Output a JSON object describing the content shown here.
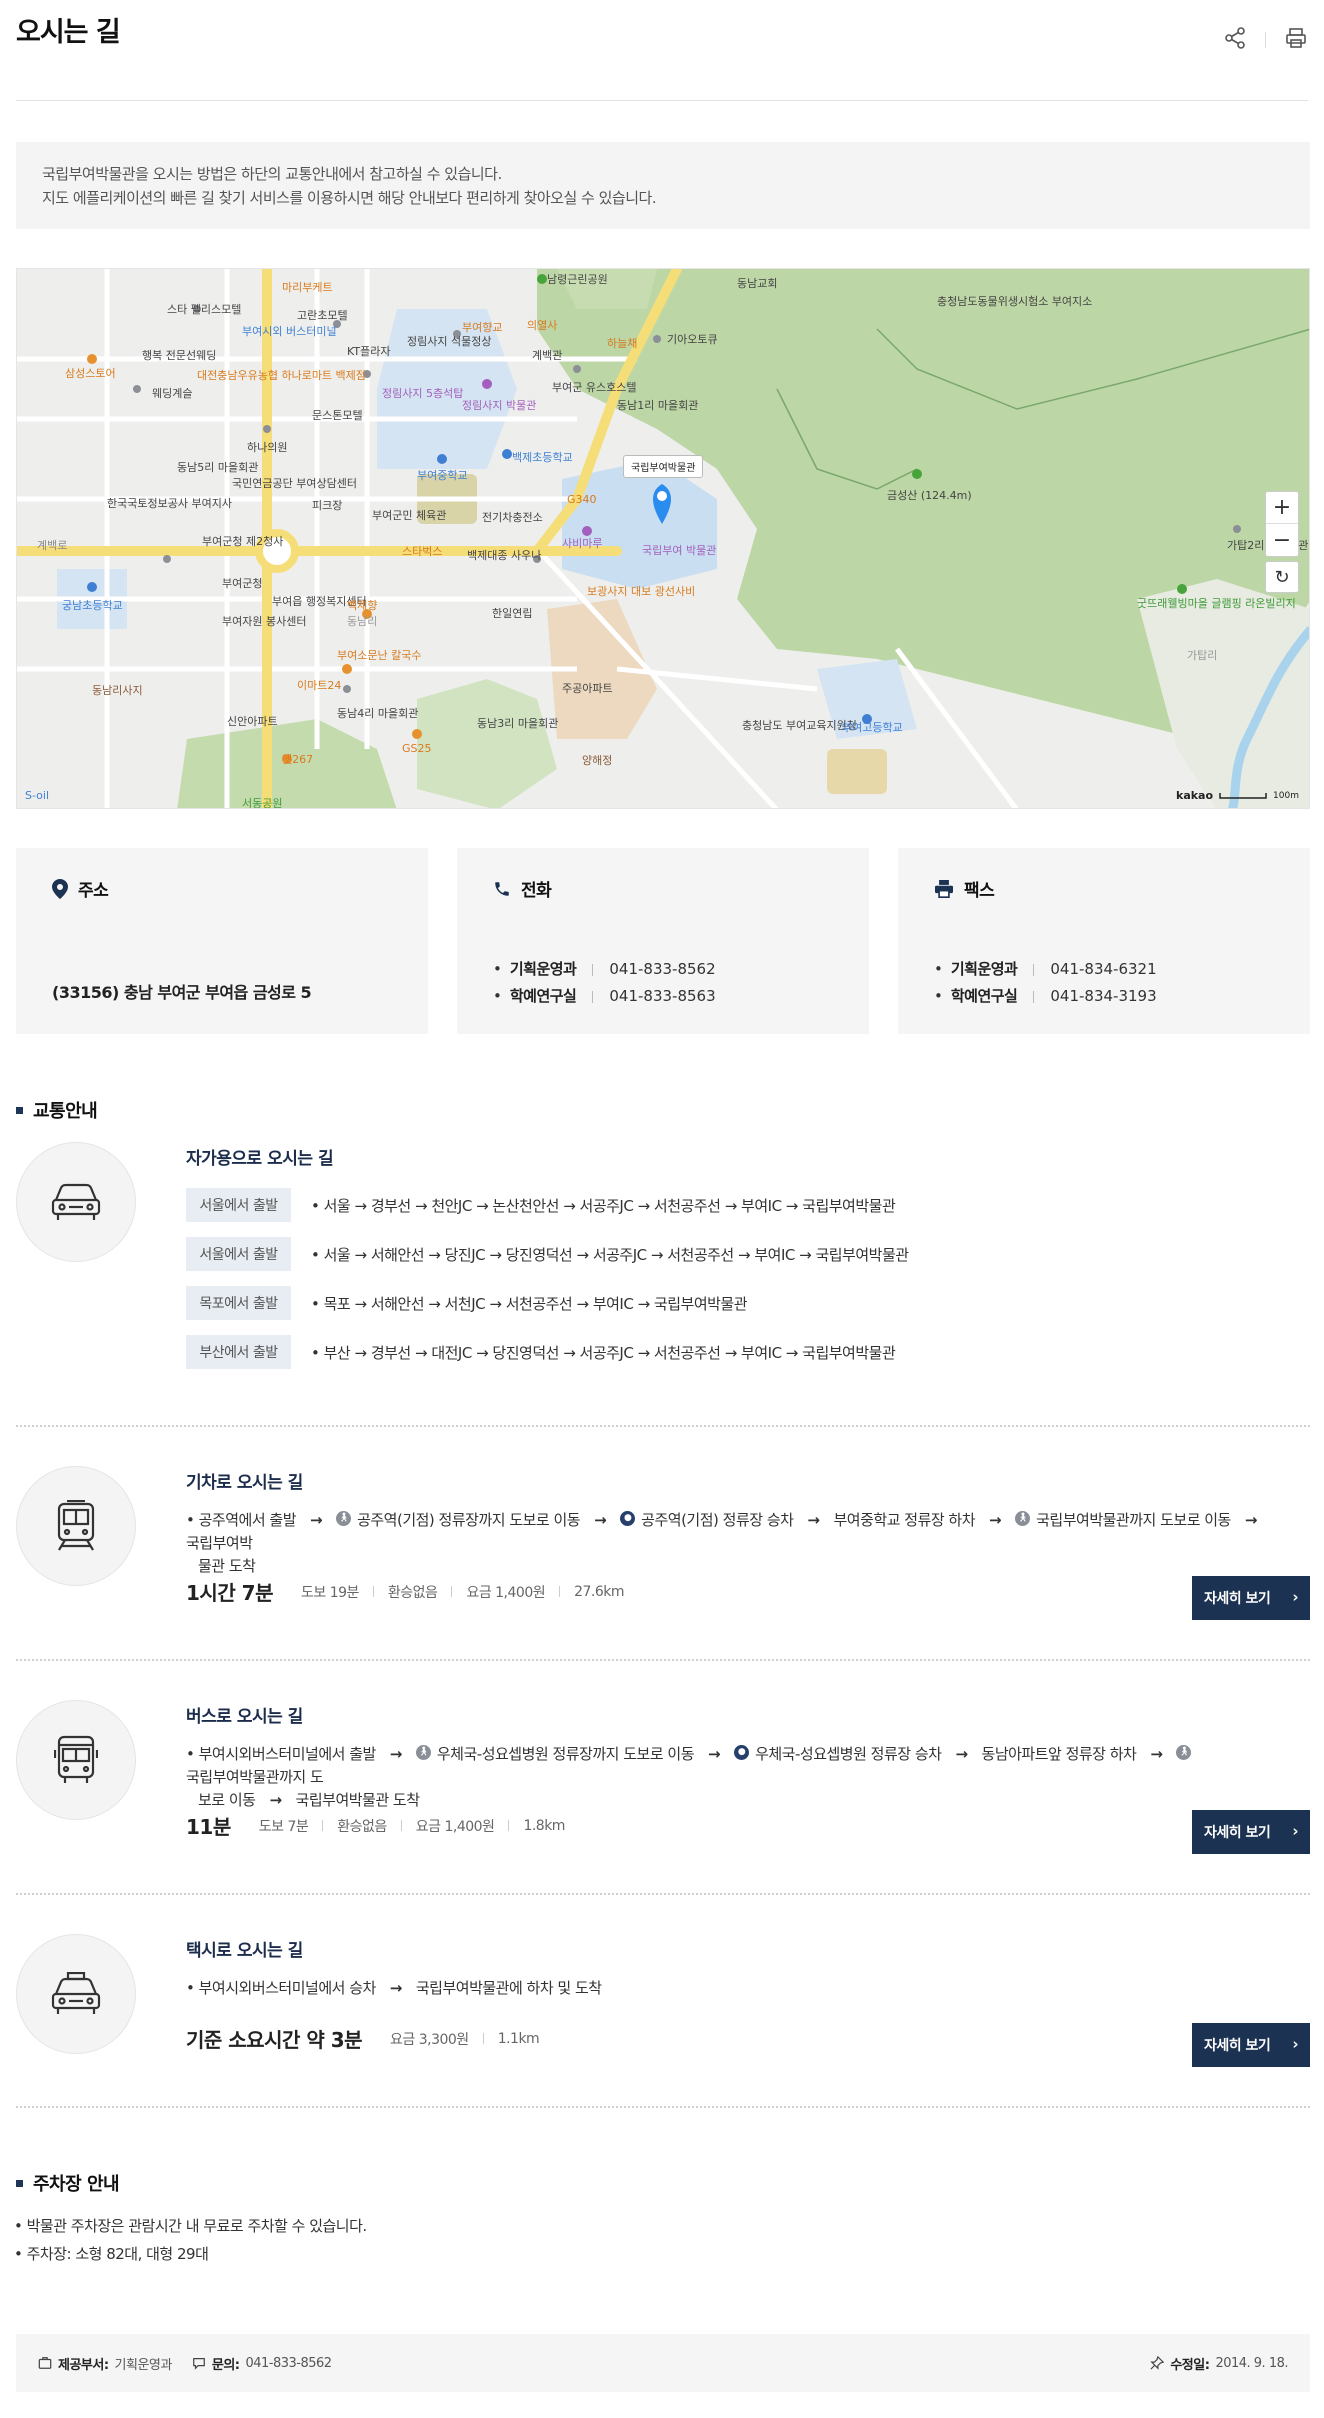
{
  "header": {
    "title": "오시는 길"
  },
  "intro": {
    "line1": "국립부여박물관을 오시는 방법은 하단의 교통안내에서 참고하실 수 있습니다.",
    "line2": "지도 에플리케이션의 빠른 길 찾기 서비스를 이용하시면 해당 안내보다 편리하게 찾아오실 수 있습니다."
  },
  "map": {
    "marker_label": "국립부여박물관",
    "brand": "kakao",
    "scale": "100m",
    "labels": [
      "남령근린공원",
      "동남교회",
      "충청남도동물위생시험소 부여지소",
      "스타 펠리스모텔",
      "마리부케트",
      "고란초모텔",
      "부여시외 버스터미널",
      "KT플라자",
      "정림사지 석물정상",
      "부여향교",
      "의열사",
      "하늘채",
      "기아오토큐",
      "계백관",
      "부여군 유스호스텔",
      "동남1리 마을회관",
      "삼성스토어",
      "행복 전문선웨딩",
      "대전충남우유농협 하나로마트 백제점",
      "웨딩계슬",
      "정림사지 5층석탑",
      "정림사지 박물관",
      "문스톤모텔",
      "하나의원",
      "백제초등학교",
      "부여중학교",
      "동남5리 마을회관",
      "국민연금공단 부여상담센터",
      "한국국토정보공사 부여지사",
      "피크장",
      "G340",
      "전기차충전소",
      "부여군민 체육관",
      "사비마루",
      "국립부여 박물관",
      "금성산 (124.4m)",
      "가탑2리 마을회관",
      "부여군청 제2청사",
      "스타벅스",
      "백제대종 사우나",
      "부여군청",
      "부여읍 행정복지센터",
      "보광사지 대보 광선사비",
      "굿뜨래웰빙마을 글램핑 라온빌리지",
      "궁남초등학교",
      "부여자원 봉사센터",
      "백제향",
      "한일연립",
      "가탑리",
      "동남리사지",
      "부여소문난 칼국수",
      "이마트24",
      "주공아파트",
      "신안아파트",
      "동남4리 마을회관",
      "동남3리 마을회관",
      "충청남도 부여교육지원청",
      "부여고등학교",
      "엣267",
      "GS25",
      "양해정",
      "서동공원",
      "S-oil",
      "계백로",
      "동남리"
    ]
  },
  "cards": {
    "address": {
      "title": "주소",
      "value": "(33156) 충남 부여군 부여읍 금성로 5"
    },
    "phone": {
      "title": "전화",
      "rows": [
        {
          "label": "기획운영과",
          "value": "041-833-8562"
        },
        {
          "label": "학예연구실",
          "value": "041-833-8563"
        }
      ]
    },
    "fax": {
      "title": "팩스",
      "rows": [
        {
          "label": "기획운영과",
          "value": "041-834-6321"
        },
        {
          "label": "학예연구실",
          "value": "041-834-3193"
        }
      ]
    }
  },
  "traffic": {
    "heading": "교통안내",
    "car": {
      "title": "자가용으로 오시는 길",
      "routes": [
        {
          "tag": "서울에서 출발",
          "route": "• 서울 → 경부선 → 천안JC → 논산천안선 → 서공주JC → 서천공주선 → 부여IC → 국립부여박물관"
        },
        {
          "tag": "서울에서 출발",
          "route": "• 서울 → 서해안선 → 당진JC → 당진영덕선 → 서공주JC → 서천공주선 → 부여IC → 국립부여박물관"
        },
        {
          "tag": "목포에서 출발",
          "route": "• 목포 → 서해안선 → 서천JC → 서천공주선 → 부여IC → 국립부여박물관"
        },
        {
          "tag": "부산에서 출발",
          "route": "• 부산 → 경부선 → 대전JC → 당진영덕선 → 서공주JC → 서천공주선 → 부여IC → 국립부여박물관"
        }
      ]
    },
    "train": {
      "title": "기차로 오시는 길",
      "s1": "공주역에서 출발",
      "s2": "공주역(기점) 정류장까지 도보로 이동",
      "s3": "공주역(기점) 정류장 승차",
      "s4": "부여중학교 정류장 하차",
      "s5": "국립부여박물관까지 도보로 이동",
      "s6": "국립부여박",
      "s6b": "물관 도착",
      "time": "1시간 7분",
      "walk": "도보 19분",
      "transfer": "환승없음",
      "fare": "요금 1,400원",
      "distance": "27.6km",
      "button": "자세히 보기"
    },
    "bus": {
      "title": "버스로 오시는 길",
      "s1": "부여시외버스터미널에서 출발",
      "s2": "우체국-성요셉병원 정류장까지 도보로 이동",
      "s3": "우체국-성요셉병원 정류장 승차",
      "s4": "동남아파트앞 정류장 하차",
      "s5": "국립부여박물관까지 도",
      "s5b": "보로 이동",
      "s6": "국립부여박물관 도착",
      "time": "11분",
      "walk": "도보 7분",
      "transfer": "환승없음",
      "fare": "요금 1,400원",
      "distance": "1.8km",
      "button": "자세히 보기"
    },
    "taxi": {
      "title": "택시로 오시는 길",
      "s1": "부여시외버스터미널에서 승차",
      "s2": "국립부여박물관에 하차 및 도착",
      "time": "기준 소요시간 약 3분",
      "fare": "요금 3,300원",
      "distance": "1.1km",
      "button": "자세히 보기"
    }
  },
  "parking": {
    "heading": "주차장 안내",
    "line1": "• 박물관 주차장은 관람시간 내 무료로 주차할 수 있습니다.",
    "line2": "• 주차장: 소형 82대, 대형 29대"
  },
  "footer": {
    "dept_label": "제공부서:",
    "dept_value": "기획운영과",
    "contact_label": "문의:",
    "contact_value": "041-833-8562",
    "updated_label": "수정일:",
    "updated_value": "2014. 9. 18."
  },
  "colors": {
    "navy": "#1c3252",
    "map_green": "#b9d4a1",
    "map_road": "#ffffff",
    "map_yellow": "#f7e07a",
    "marker": "#2b8cf0"
  }
}
